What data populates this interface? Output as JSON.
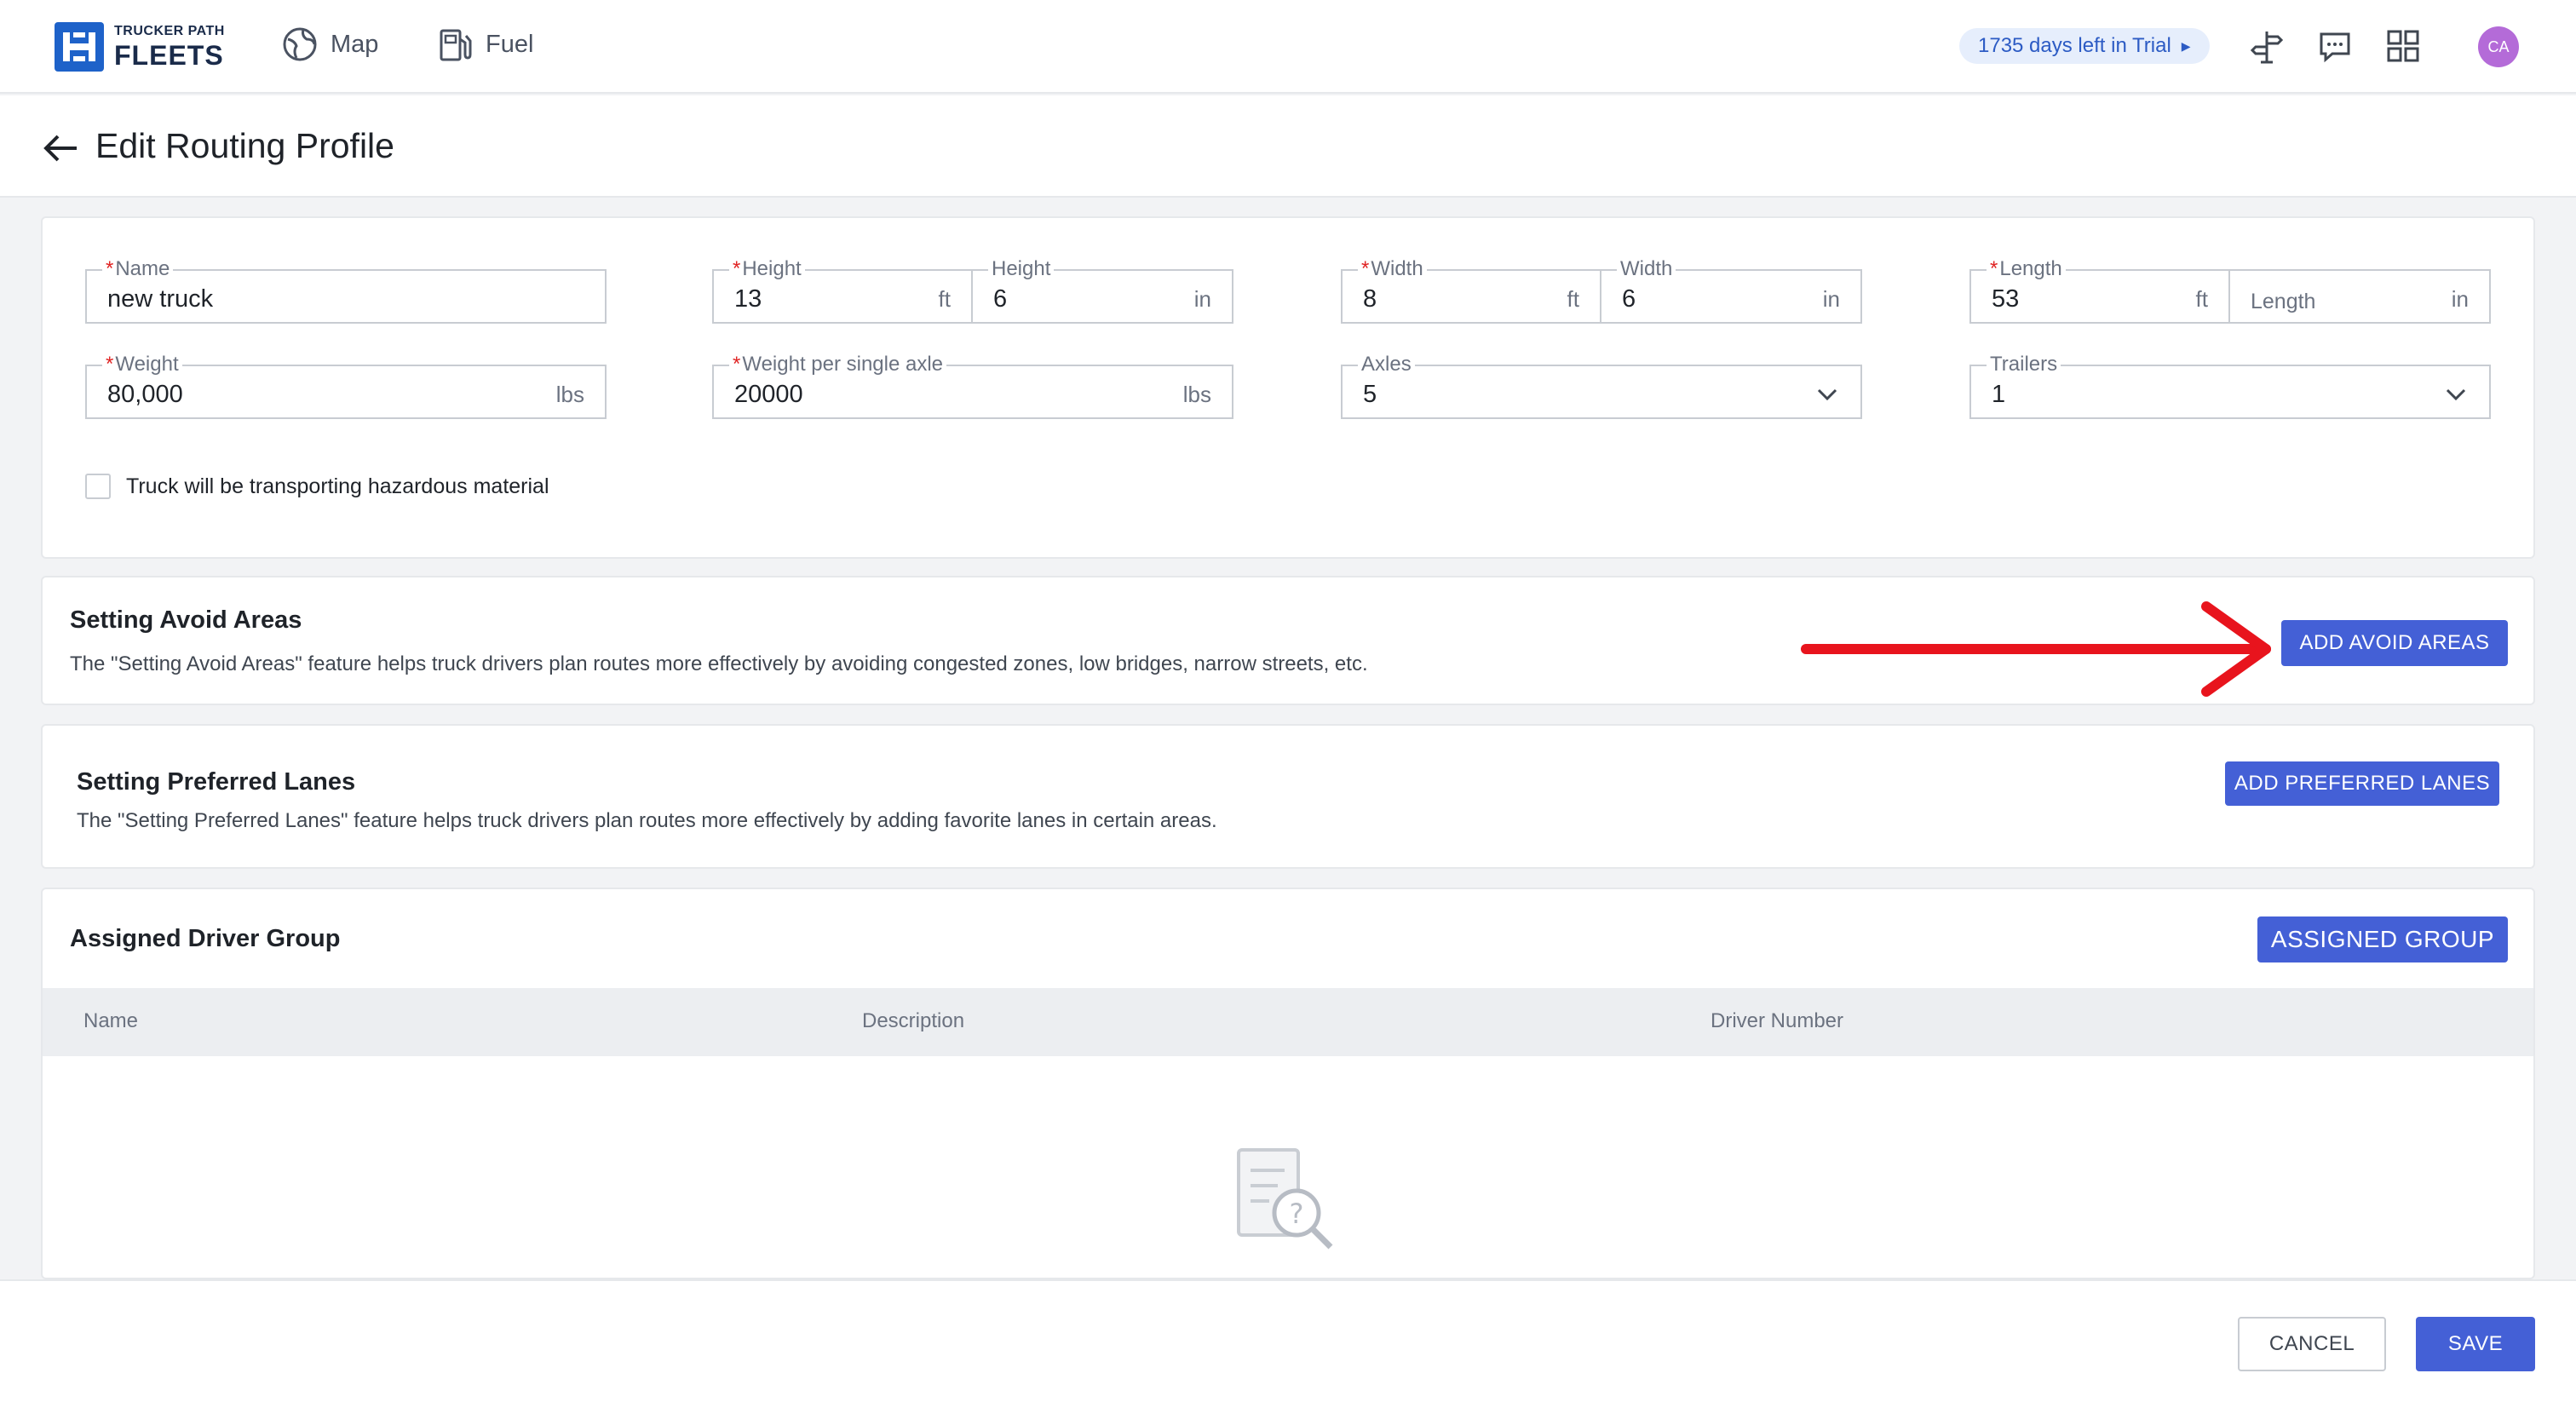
{
  "brand": {
    "line1": "TRUCKER PATH",
    "line2": "FLEETS"
  },
  "nav": {
    "map_label": "Map",
    "fuel_label": "Fuel"
  },
  "trial": {
    "text": "1735 days left in Trial"
  },
  "avatar": {
    "initials": "CA",
    "color": "#b46bd8"
  },
  "header": {
    "title": "Edit Routing Profile"
  },
  "form": {
    "name": {
      "label": "Name",
      "value": "new truck"
    },
    "height_ft": {
      "label": "Height",
      "value": "13",
      "unit": "ft"
    },
    "height_in": {
      "label": "Height",
      "value": "6",
      "unit": "in"
    },
    "width_ft": {
      "label": "Width",
      "value": "8",
      "unit": "ft"
    },
    "width_in": {
      "label": "Width",
      "value": "6",
      "unit": "in"
    },
    "length_ft": {
      "label": "Length",
      "value": "53",
      "unit": "ft"
    },
    "length_in": {
      "placeholder": "Length",
      "unit": "in"
    },
    "weight": {
      "label": "Weight",
      "value": "80,000",
      "unit": "lbs"
    },
    "axle_weight": {
      "label": "Weight per single axle",
      "value": "20000",
      "unit": "lbs"
    },
    "axles": {
      "label": "Axles",
      "value": "5"
    },
    "trailers": {
      "label": "Trailers",
      "value": "1"
    },
    "hazmat_label": "Truck will be transporting hazardous material",
    "required_mark": "*"
  },
  "avoid": {
    "title": "Setting Avoid Areas",
    "description": "The \"Setting Avoid Areas\" feature helps truck drivers plan routes more effectively by avoiding congested zones, low bridges, narrow streets, etc.",
    "button": "ADD AVOID AREAS"
  },
  "lanes": {
    "title": "Setting Preferred Lanes",
    "description": "The \"Setting Preferred Lanes\" feature helps truck drivers plan routes more effectively by adding favorite lanes in certain areas.",
    "button": "ADD PREFERRED LANES"
  },
  "group": {
    "title": "Assigned Driver Group",
    "button": "ASSIGNED GROUP",
    "columns": [
      "Name",
      "Description",
      "Driver Number"
    ]
  },
  "footer": {
    "cancel": "CANCEL",
    "save": "SAVE"
  },
  "colors": {
    "primary": "#4460d6",
    "required": "#e02424",
    "annotation": "#e8141d"
  }
}
